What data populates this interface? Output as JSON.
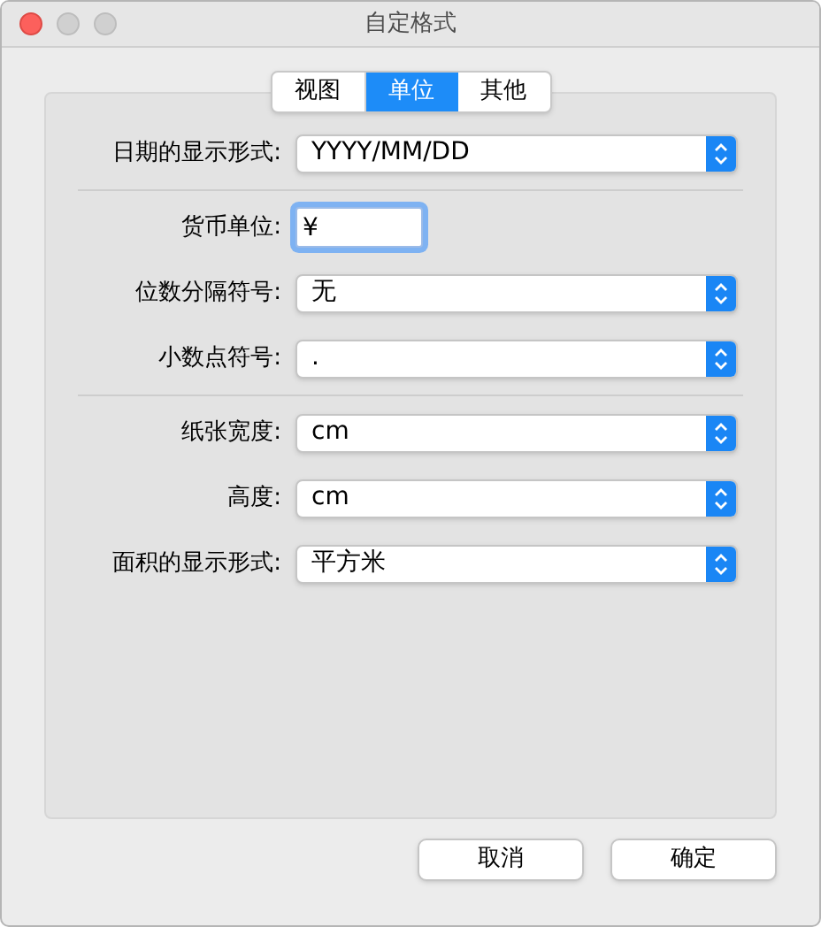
{
  "window": {
    "title": "自定格式"
  },
  "tabs": [
    {
      "label": "视图",
      "selected": false
    },
    {
      "label": "单位",
      "selected": true
    },
    {
      "label": "其他",
      "selected": false
    }
  ],
  "groups": [
    {
      "rows": [
        {
          "kind": "popup",
          "label": "日期的显示形式:",
          "value": "YYYY/MM/DD"
        }
      ]
    },
    {
      "rows": [
        {
          "kind": "field",
          "label": "货币单位:",
          "value": "¥",
          "focused": true
        },
        {
          "kind": "popup",
          "label": "位数分隔符号:",
          "value": "无"
        },
        {
          "kind": "popup",
          "label": "小数点符号:",
          "value": "."
        }
      ]
    },
    {
      "rows": [
        {
          "kind": "popup",
          "label": "纸张宽度:",
          "value": "cm"
        },
        {
          "kind": "popup",
          "label": "高度:",
          "value": "cm"
        },
        {
          "kind": "popup",
          "label": "面积的显示形式:",
          "value": "平方米"
        }
      ]
    }
  ],
  "buttons": [
    "取消",
    "确定"
  ]
}
